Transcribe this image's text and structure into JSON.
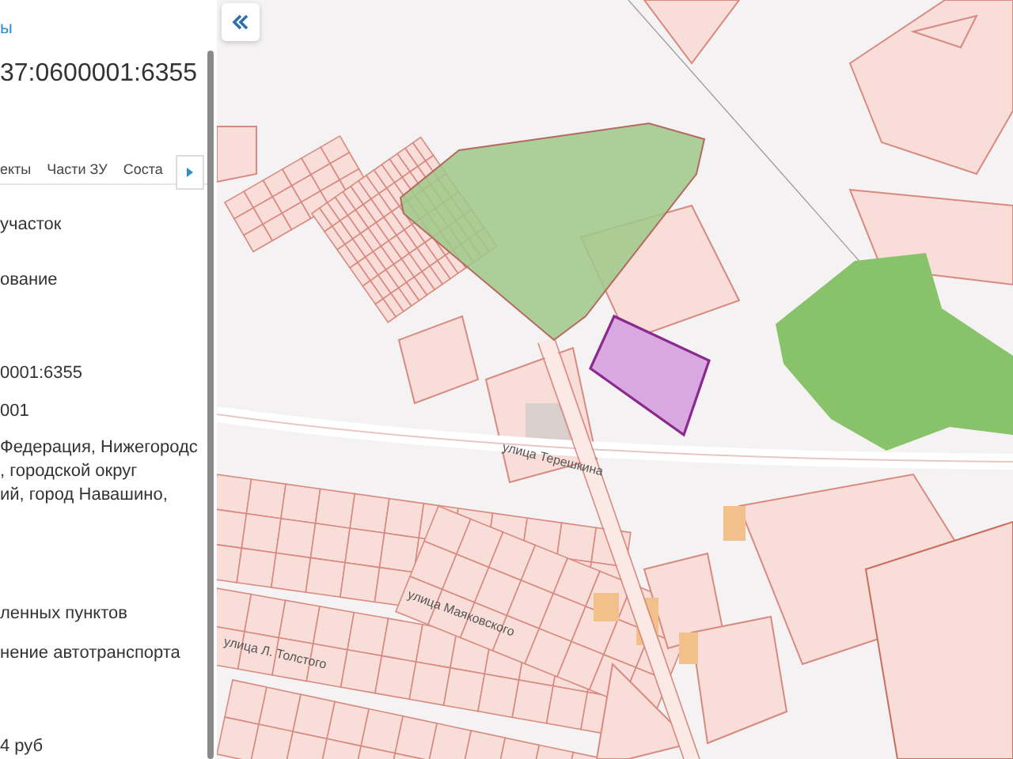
{
  "panel": {
    "link": "ы",
    "title": "37:0600001:6355",
    "tabs": [
      {
        "label": "екты"
      },
      {
        "label": "Части ЗУ"
      },
      {
        "label": "Соста"
      }
    ],
    "rows": [
      {
        "text": "участок"
      },
      {
        "text": "ование"
      },
      {
        "text": "0001:6355"
      },
      {
        "text": "001"
      },
      {
        "text": "Федерация, Нижегородс\n, городской округ\nий, город Навашино,"
      },
      {
        "text": "ленных пунктов"
      },
      {
        "text": "нение автотранспорта"
      },
      {
        "text": "4 руб"
      }
    ]
  },
  "map": {
    "streets": [
      {
        "name": "улица Терешкина"
      },
      {
        "name": "улица Маяковского"
      },
      {
        "name": "улица Л. Толстого"
      }
    ]
  }
}
